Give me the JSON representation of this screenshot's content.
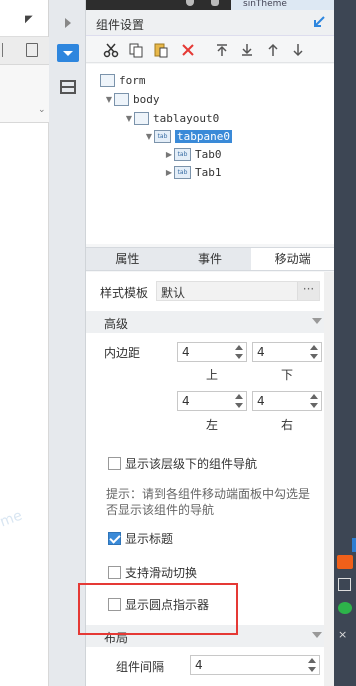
{
  "top_strip": {
    "theme_text": "sinTheme"
  },
  "panel": {
    "title": "组件设置"
  },
  "toolbar": {
    "buttons": [
      "cut-icon",
      "copy-icon",
      "paste-icon",
      "delete-icon",
      "move-top-icon",
      "move-bottom-icon",
      "move-up-icon",
      "move-down-icon"
    ]
  },
  "tree": {
    "nodes": [
      {
        "label": "form"
      },
      {
        "label": "body"
      },
      {
        "label": "tablayout0"
      },
      {
        "label": "tabpane0",
        "selected": true
      },
      {
        "label": "Tab0"
      },
      {
        "label": "Tab1"
      }
    ],
    "tab_icon_text": "tab"
  },
  "tabs": [
    {
      "label": "属性"
    },
    {
      "label": "事件"
    },
    {
      "label": "移动端",
      "active": true
    }
  ],
  "props": {
    "style_template_label": "样式模板",
    "style_template_value": "默认",
    "style_template_more": "···",
    "section_advanced": "高级",
    "padding_label": "内边距",
    "padding": {
      "top": "4",
      "bottom": "4",
      "left": "4",
      "right": "4",
      "top_label": "上",
      "bottom_label": "下",
      "left_label": "左",
      "right_label": "右"
    },
    "show_nav_label": "显示该层级下的组件导航",
    "show_nav_checked": false,
    "hint": "提示：请到各组件移动端面板中勾选是否显示该组件的导航",
    "show_title_label": "显示标题",
    "show_title_checked": true,
    "swipe_label": "支持滑动切换",
    "swipe_checked": false,
    "dot_indicator_label": "显示圆点指示器",
    "dot_indicator_checked": false,
    "section_layout": "布局",
    "spacing_label": "组件间隔",
    "spacing_value": "4"
  },
  "left_strip": {
    "watermark": "me"
  },
  "colors": {
    "accent": "#3a8ad8",
    "highlight": "#e53935"
  }
}
